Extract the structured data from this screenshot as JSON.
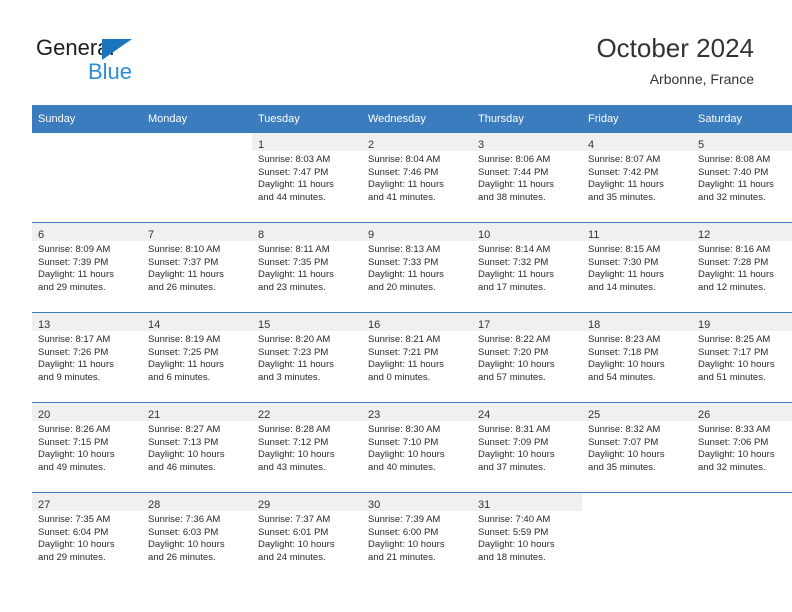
{
  "logo": {
    "line1": "General",
    "line2": "Blue",
    "triangle_color": "#1b75bb",
    "blue_text_color": "#2b8fd4"
  },
  "header": {
    "title": "October 2024",
    "subtitle": "Arbonne, France"
  },
  "theme": {
    "header_row_bg": "#3a7cbe",
    "header_row_text": "#ffffff",
    "daynum_band_bg": "#f0f0f0",
    "row_divider": "#3a7cbe",
    "body_text": "#2a2a2a"
  },
  "labels": {
    "sunrise_prefix": "Sunrise:",
    "sunset_prefix": "Sunset:",
    "daylight_prefix": "Daylight:"
  },
  "weekday_headers": [
    "Sunday",
    "Monday",
    "Tuesday",
    "Wednesday",
    "Thursday",
    "Friday",
    "Saturday"
  ],
  "weeks": [
    [
      {
        "day": "",
        "lines": []
      },
      {
        "day": "",
        "lines": []
      },
      {
        "day": "1",
        "lines": [
          "Sunrise: 8:03 AM",
          "Sunset: 7:47 PM",
          "Daylight: 11 hours",
          "and 44 minutes."
        ]
      },
      {
        "day": "2",
        "lines": [
          "Sunrise: 8:04 AM",
          "Sunset: 7:46 PM",
          "Daylight: 11 hours",
          "and 41 minutes."
        ]
      },
      {
        "day": "3",
        "lines": [
          "Sunrise: 8:06 AM",
          "Sunset: 7:44 PM",
          "Daylight: 11 hours",
          "and 38 minutes."
        ]
      },
      {
        "day": "4",
        "lines": [
          "Sunrise: 8:07 AM",
          "Sunset: 7:42 PM",
          "Daylight: 11 hours",
          "and 35 minutes."
        ]
      },
      {
        "day": "5",
        "lines": [
          "Sunrise: 8:08 AM",
          "Sunset: 7:40 PM",
          "Daylight: 11 hours",
          "and 32 minutes."
        ]
      }
    ],
    [
      {
        "day": "6",
        "lines": [
          "Sunrise: 8:09 AM",
          "Sunset: 7:39 PM",
          "Daylight: 11 hours",
          "and 29 minutes."
        ]
      },
      {
        "day": "7",
        "lines": [
          "Sunrise: 8:10 AM",
          "Sunset: 7:37 PM",
          "Daylight: 11 hours",
          "and 26 minutes."
        ]
      },
      {
        "day": "8",
        "lines": [
          "Sunrise: 8:11 AM",
          "Sunset: 7:35 PM",
          "Daylight: 11 hours",
          "and 23 minutes."
        ]
      },
      {
        "day": "9",
        "lines": [
          "Sunrise: 8:13 AM",
          "Sunset: 7:33 PM",
          "Daylight: 11 hours",
          "and 20 minutes."
        ]
      },
      {
        "day": "10",
        "lines": [
          "Sunrise: 8:14 AM",
          "Sunset: 7:32 PM",
          "Daylight: 11 hours",
          "and 17 minutes."
        ]
      },
      {
        "day": "11",
        "lines": [
          "Sunrise: 8:15 AM",
          "Sunset: 7:30 PM",
          "Daylight: 11 hours",
          "and 14 minutes."
        ]
      },
      {
        "day": "12",
        "lines": [
          "Sunrise: 8:16 AM",
          "Sunset: 7:28 PM",
          "Daylight: 11 hours",
          "and 12 minutes."
        ]
      }
    ],
    [
      {
        "day": "13",
        "lines": [
          "Sunrise: 8:17 AM",
          "Sunset: 7:26 PM",
          "Daylight: 11 hours",
          "and 9 minutes."
        ]
      },
      {
        "day": "14",
        "lines": [
          "Sunrise: 8:19 AM",
          "Sunset: 7:25 PM",
          "Daylight: 11 hours",
          "and 6 minutes."
        ]
      },
      {
        "day": "15",
        "lines": [
          "Sunrise: 8:20 AM",
          "Sunset: 7:23 PM",
          "Daylight: 11 hours",
          "and 3 minutes."
        ]
      },
      {
        "day": "16",
        "lines": [
          "Sunrise: 8:21 AM",
          "Sunset: 7:21 PM",
          "Daylight: 11 hours",
          "and 0 minutes."
        ]
      },
      {
        "day": "17",
        "lines": [
          "Sunrise: 8:22 AM",
          "Sunset: 7:20 PM",
          "Daylight: 10 hours",
          "and 57 minutes."
        ]
      },
      {
        "day": "18",
        "lines": [
          "Sunrise: 8:23 AM",
          "Sunset: 7:18 PM",
          "Daylight: 10 hours",
          "and 54 minutes."
        ]
      },
      {
        "day": "19",
        "lines": [
          "Sunrise: 8:25 AM",
          "Sunset: 7:17 PM",
          "Daylight: 10 hours",
          "and 51 minutes."
        ]
      }
    ],
    [
      {
        "day": "20",
        "lines": [
          "Sunrise: 8:26 AM",
          "Sunset: 7:15 PM",
          "Daylight: 10 hours",
          "and 49 minutes."
        ]
      },
      {
        "day": "21",
        "lines": [
          "Sunrise: 8:27 AM",
          "Sunset: 7:13 PM",
          "Daylight: 10 hours",
          "and 46 minutes."
        ]
      },
      {
        "day": "22",
        "lines": [
          "Sunrise: 8:28 AM",
          "Sunset: 7:12 PM",
          "Daylight: 10 hours",
          "and 43 minutes."
        ]
      },
      {
        "day": "23",
        "lines": [
          "Sunrise: 8:30 AM",
          "Sunset: 7:10 PM",
          "Daylight: 10 hours",
          "and 40 minutes."
        ]
      },
      {
        "day": "24",
        "lines": [
          "Sunrise: 8:31 AM",
          "Sunset: 7:09 PM",
          "Daylight: 10 hours",
          "and 37 minutes."
        ]
      },
      {
        "day": "25",
        "lines": [
          "Sunrise: 8:32 AM",
          "Sunset: 7:07 PM",
          "Daylight: 10 hours",
          "and 35 minutes."
        ]
      },
      {
        "day": "26",
        "lines": [
          "Sunrise: 8:33 AM",
          "Sunset: 7:06 PM",
          "Daylight: 10 hours",
          "and 32 minutes."
        ]
      }
    ],
    [
      {
        "day": "27",
        "lines": [
          "Sunrise: 7:35 AM",
          "Sunset: 6:04 PM",
          "Daylight: 10 hours",
          "and 29 minutes."
        ]
      },
      {
        "day": "28",
        "lines": [
          "Sunrise: 7:36 AM",
          "Sunset: 6:03 PM",
          "Daylight: 10 hours",
          "and 26 minutes."
        ]
      },
      {
        "day": "29",
        "lines": [
          "Sunrise: 7:37 AM",
          "Sunset: 6:01 PM",
          "Daylight: 10 hours",
          "and 24 minutes."
        ]
      },
      {
        "day": "30",
        "lines": [
          "Sunrise: 7:39 AM",
          "Sunset: 6:00 PM",
          "Daylight: 10 hours",
          "and 21 minutes."
        ]
      },
      {
        "day": "31",
        "lines": [
          "Sunrise: 7:40 AM",
          "Sunset: 5:59 PM",
          "Daylight: 10 hours",
          "and 18 minutes."
        ]
      },
      {
        "day": "",
        "lines": []
      },
      {
        "day": "",
        "lines": []
      }
    ]
  ]
}
